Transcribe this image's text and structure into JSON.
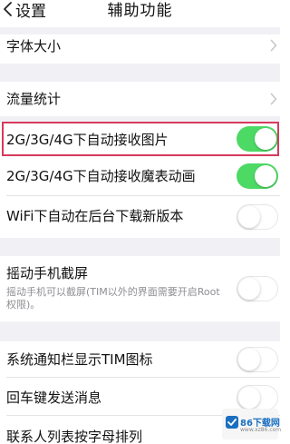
{
  "nav": {
    "back_label": "设置",
    "title": "辅助功能"
  },
  "rows": {
    "font_size": {
      "label": "字体大小"
    },
    "traffic_stats": {
      "label": "流量统计"
    },
    "auto_receive_images": {
      "label": "2G/3G/4G下自动接收图片",
      "enabled": true
    },
    "auto_receive_emoji": {
      "label": "2G/3G/4G下自动接收魔表动画",
      "enabled": true
    },
    "wifi_auto_download": {
      "label": "WiFi下自动在后台下载新版本",
      "enabled": false
    },
    "shake_screenshot": {
      "label": "摇动手机截屏",
      "description": "摇动手机可以截屏(TIM以外的界面需要开启Root权限)。",
      "enabled": false
    },
    "notification_icon": {
      "label": "系统通知栏显示TIM图标",
      "enabled": false
    },
    "enter_to_send": {
      "label": "回车键发送消息",
      "enabled": false
    },
    "contacts_sort": {
      "label": "联系人列表按字母排列"
    }
  },
  "watermark": {
    "text": "86下载网",
    "sub": "www.xz86.com"
  },
  "colors": {
    "toggle_on": "#4cd964",
    "highlight": "#d63a5c",
    "section_gap": "#f1f1f5"
  },
  "icons": {
    "back": "chevron-left-icon",
    "disclosure": "chevron-right-icon"
  }
}
